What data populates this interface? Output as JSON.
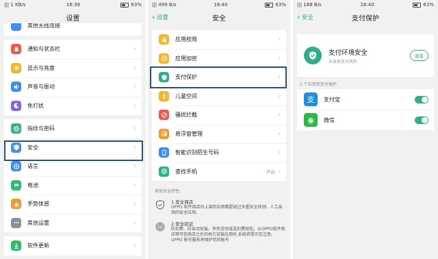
{
  "screen1": {
    "status": {
      "left": "|||  1 KB/s",
      "time": "16:39",
      "right": "63%"
    },
    "title": "设置",
    "cut_item": "其他无线连接",
    "group1": [
      {
        "label": "通知与状态栏",
        "color": "#f4564a",
        "icon": "bell-icon"
      },
      {
        "label": "显示与亮度",
        "color": "#f6b52b",
        "icon": "sun-icon"
      },
      {
        "label": "声音与振动",
        "color": "#3b8ff5",
        "icon": "speaker-icon"
      },
      {
        "label": "免打扰",
        "color": "#8566e8",
        "icon": "moon-icon"
      }
    ],
    "group2": [
      {
        "label": "指纹与密码",
        "color": "#33b38a",
        "icon": "fingerprint-icon"
      },
      {
        "label": "安全",
        "color": "#4a8ff7",
        "icon": "shield-icon"
      },
      {
        "label": "语言",
        "color": "#3b8ff5",
        "icon": "globe-icon"
      },
      {
        "label": "电池",
        "color": "#2fbf6c",
        "icon": "battery-icon"
      },
      {
        "label": "手势体感",
        "color": "#f39a2c",
        "icon": "hand-icon"
      },
      {
        "label": "其他设置",
        "color": "#8c8f98",
        "icon": "more-icon"
      }
    ],
    "group3": [
      {
        "label": "软件更新",
        "color": "#2fbf6c",
        "icon": "update-icon"
      }
    ]
  },
  "screen2": {
    "status": {
      "left": "|||  499 B/s",
      "time": "16:40",
      "right": "63%"
    },
    "back": "设置",
    "title": "安全",
    "items": [
      {
        "label": "应用权限",
        "color": "#f6b52b",
        "icon": "lock-icon",
        "value": ""
      },
      {
        "label": "应用加密",
        "color": "#f6b52b",
        "icon": "app-lock-icon",
        "value": ""
      },
      {
        "label": "支付保护",
        "color": "#2bb087",
        "icon": "shield-icon",
        "value": ""
      },
      {
        "label": "儿童空间",
        "color": "#f6b52b",
        "icon": "child-icon",
        "value": ""
      },
      {
        "label": "骚扰拦截",
        "color": "#f4564a",
        "icon": "block-icon",
        "value": ""
      },
      {
        "label": "悬浮窗管理",
        "color": "#f39a2c",
        "icon": "window-icon",
        "value": ""
      },
      {
        "label": "智能识别陌生号码",
        "color": "#3b8ff5",
        "icon": "phone-icon",
        "value": ""
      },
      {
        "label": "查找手机",
        "color": "#2bb087",
        "icon": "radar-icon",
        "value": "开启"
      }
    ],
    "note": "其他安全特性:",
    "features": [
      {
        "head": "1.安全商店",
        "body": "OPPO 软件商店内上架的应用都是经过多重安全检测、人工亲测的安全应用。"
      },
      {
        "head": "2.安全验证",
        "body": "防扣费、防自动安装、杀死流氓或送扣费短信。从OPPO软件商店等可信商店之外的地方安装应用时,系统将提示您注意。OPPO 帐号服务将保护您的帐号"
      }
    ]
  },
  "screen3": {
    "status": {
      "left": "|||  188 B/s",
      "time": "16:40",
      "right": "63%"
    },
    "back": "安全",
    "title": "支付保护",
    "card_title": "支付环境安全",
    "card_sub": "未发现支付风险",
    "card_btn": "查看",
    "section": "2 个应用受支付保护",
    "apps": [
      {
        "label": "支付宝",
        "color": "#1f8ee8",
        "icon": "alipay-icon",
        "glyph": "支"
      },
      {
        "label": "微信",
        "color": "#2bbb3f",
        "icon": "wechat-icon",
        "glyph": "◉"
      }
    ]
  }
}
